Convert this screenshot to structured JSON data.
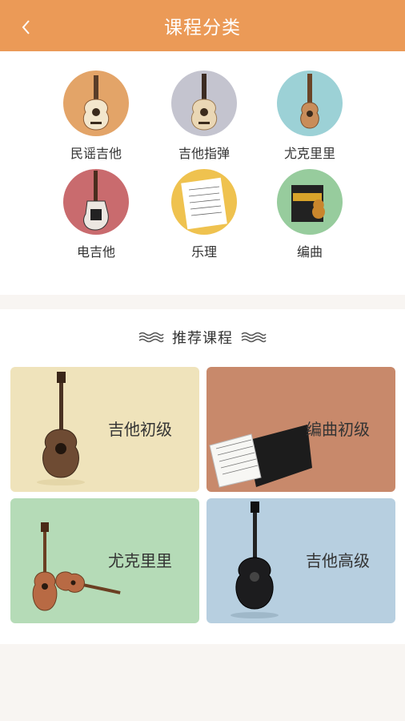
{
  "header": {
    "title": "课程分类",
    "back_icon": "chevron-left-icon",
    "background": "#eb9a57"
  },
  "categories": [
    {
      "label": "民谣吉他",
      "color": "#e3a468"
    },
    {
      "label": "吉他指弹",
      "color": "#c4c4cf"
    },
    {
      "label": "尤克里里",
      "color": "#9cd1d6"
    },
    {
      "label": "电吉他",
      "color": "#c96b6e"
    },
    {
      "label": "乐理",
      "color": "#efc24f"
    },
    {
      "label": "编曲",
      "color": "#97cc9d"
    }
  ],
  "recommend": {
    "title": "推荐课程",
    "decor_icon": "wave-icon"
  },
  "cards": [
    {
      "label": "吉他初级",
      "color": "#efe3bb"
    },
    {
      "label": "编曲初级",
      "color": "#c8896b"
    },
    {
      "label": "尤克里里",
      "color": "#b5dbb7"
    },
    {
      "label": "吉他高级",
      "color": "#b7cfe0"
    }
  ]
}
